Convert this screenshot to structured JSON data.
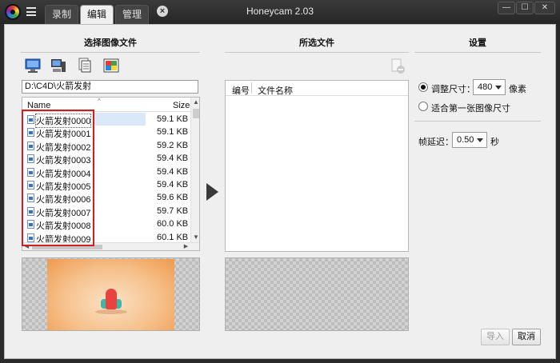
{
  "window": {
    "title": "Honeycam 2.03",
    "minimize": "—",
    "maximize": "☐",
    "close": "✕"
  },
  "tabs": [
    {
      "label": "录制",
      "active": false
    },
    {
      "label": "编辑",
      "active": true
    },
    {
      "label": "管理",
      "active": false
    }
  ],
  "tab_close": "×",
  "left": {
    "title": "选择图像文件",
    "toolbar": [
      "desktop-icon",
      "computer-icon",
      "documents-icon",
      "pictures-icon"
    ],
    "path": "D:\\C4D\\火箭发射",
    "columns": {
      "name": "Name",
      "size": "Size"
    },
    "files": [
      {
        "name": "火箭发射0000",
        "size": "59.1 KB"
      },
      {
        "name": "火箭发射0001",
        "size": "59.1 KB"
      },
      {
        "name": "火箭发射0002",
        "size": "59.2 KB"
      },
      {
        "name": "火箭发射0003",
        "size": "59.4 KB"
      },
      {
        "name": "火箭发射0004",
        "size": "59.4 KB"
      },
      {
        "name": "火箭发射0005",
        "size": "59.4 KB"
      },
      {
        "name": "火箭发射0006",
        "size": "59.6 KB"
      },
      {
        "name": "火箭发射0007",
        "size": "59.7 KB"
      },
      {
        "name": "火箭发射0008",
        "size": "60.0 KB"
      },
      {
        "name": "火箭发射0009",
        "size": "60.1 KB"
      }
    ],
    "selected_index": 0
  },
  "middle": {
    "title": "所选文件",
    "columns": {
      "index": "编号",
      "filename": "文件名称"
    }
  },
  "settings": {
    "title": "设置",
    "resize_label": "调整尺寸：",
    "resize_value": "480",
    "resize_unit": "像素",
    "fit_first_label": "适合第一张图像尺寸",
    "delay_label": "帧延迟：",
    "delay_value": "0.50",
    "delay_unit": "秒"
  },
  "buttons": {
    "import": "导入",
    "cancel": "取消"
  },
  "colors": {
    "highlight": "#d21e1e",
    "selection": "#dbe8f8"
  }
}
